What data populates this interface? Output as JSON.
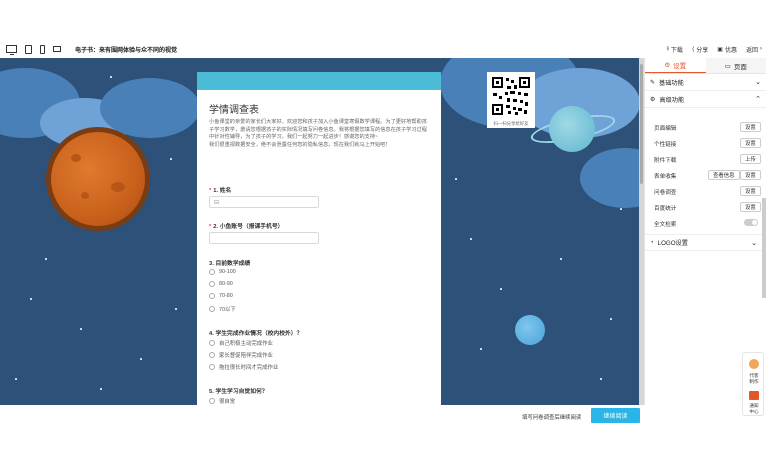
{
  "toolbar": {
    "doc_title": "电子书：来有围网体验与众不同的视觉",
    "actions": [
      {
        "icon": "download-icon",
        "label": "下载"
      },
      {
        "icon": "share-icon",
        "label": "分享"
      },
      {
        "icon": "cart-icon",
        "label": "优惠"
      },
      {
        "icon": "back-icon",
        "label": "返回"
      }
    ]
  },
  "form": {
    "title": "学情调查表",
    "intro": "小鱼课堂的亲爱的家长们大家好，欢迎您和孩子加入小鱼课堂寒假数学课程。为了更好地帮助孩子学习数学，邀请您根据孩子的实际情况填写问卷信息。我将根据您填写的信息在孩子学习过程中针对性辅导，为了孩子的学习，我们一起努力一起进步！感谢您的支持~",
    "intro2": "我们很重视数据安全，绝不会泄露任何您的隐私信息。现在我们就马上开始吧！",
    "questions": [
      {
        "num": "1. 姓名",
        "required": "*"
      },
      {
        "num": "2. 小鱼账号（报课手机号）",
        "required": "*"
      },
      {
        "num": "3. 目前数学成绩",
        "options": [
          "90-100",
          "80-90",
          "70-80",
          "70以下"
        ]
      },
      {
        "num": "4. 学生完成作业情况（校内校外）？",
        "options": [
          "自己积极主动完成作业",
          "家长督促陪伴完成作业",
          "拖拉很长时间才完成作业"
        ]
      },
      {
        "num": "5. 学生学习自觉如何？",
        "options": [
          "很自觉"
        ]
      }
    ]
  },
  "qr": {
    "caption": "扫一扫分享给好友"
  },
  "panel": {
    "tabs": [
      {
        "label": "设置"
      },
      {
        "label": "页面"
      }
    ],
    "sections": {
      "basic": "基础功能",
      "advanced": "高级功能",
      "logo": "LOGO设置"
    },
    "rows": [
      {
        "label": "页面编辑",
        "btn": "设置"
      },
      {
        "label": "个性链接",
        "btn": "设置"
      },
      {
        "label": "附件下载",
        "btn": "上传"
      },
      {
        "label": "表单收集",
        "btn": "设置",
        "btn2": "查看信息"
      },
      {
        "label": "问卷调查",
        "btn": "设置"
      },
      {
        "label": "百度统计",
        "btn": "设置"
      },
      {
        "label": "全文检索"
      }
    ]
  },
  "float": {
    "top_label_1": "代客",
    "top_label_2": "制作",
    "bottom_label_1": "通知",
    "bottom_label_2": "中心"
  },
  "bottom": {
    "text": "填写问卷调查后继续阅读",
    "button": "继续阅读"
  },
  "colors": {
    "accent": "#e4572e",
    "header": "#4bbcd6",
    "canvas": "#2d5178",
    "button": "#29b6e6"
  }
}
